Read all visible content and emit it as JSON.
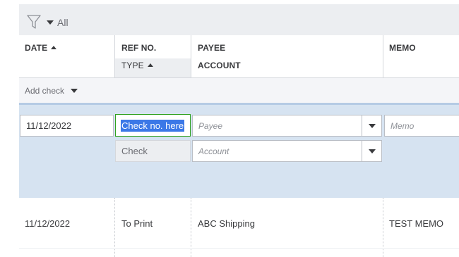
{
  "filter": {
    "label": "All",
    "icon": "funnel-icon"
  },
  "columns": {
    "date": "DATE",
    "ref_no": "REF NO.",
    "type": "TYPE",
    "payee": "PAYEE",
    "account": "ACCOUNT",
    "memo": "MEMO"
  },
  "add_check": {
    "label": "Add check"
  },
  "edit_row": {
    "date": "11/12/2022",
    "ref_no": "Check no. here",
    "type": "Check",
    "payee_placeholder": "Payee",
    "account_placeholder": "Account",
    "memo_placeholder": "Memo"
  },
  "rows": [
    {
      "date": "11/12/2022",
      "type": "To Print",
      "payee": "ABC Shipping",
      "memo": "TEST MEMO"
    }
  ],
  "colors": {
    "selected_row_bg": "#d6e3f1",
    "focus_border": "#2ca01c",
    "text_selection": "#3b78e7"
  }
}
